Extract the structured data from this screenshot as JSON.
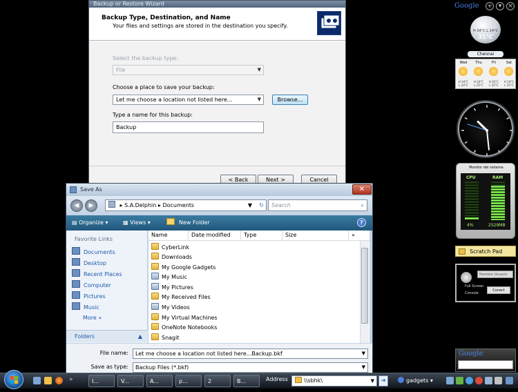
{
  "wizard": {
    "window_title": "Backup or Restore Wizard",
    "heading": "Backup Type, Destination, and Name",
    "subheading": "Your files and settings are stored in the destination you specify.",
    "backup_type_label": "Select the backup type:",
    "backup_type_value": "File",
    "place_label": "Choose a place to save your backup:",
    "place_value": "Let me choose a location not listed here...",
    "browse_label": "Browse...",
    "name_label": "Type a name for this backup:",
    "name_value": "Backup",
    "back_label": "< Back",
    "next_label": "Next >",
    "cancel_label": "Cancel"
  },
  "save_dialog": {
    "title": "Save As",
    "breadcrumb": [
      "S.A.Delphin",
      "Documents"
    ],
    "search_placeholder": "Search",
    "toolbar": {
      "organize": "Organize",
      "views": "Views",
      "new_folder": "New Folder"
    },
    "favorite_links_label": "Favorite Links",
    "favorites": [
      "Documents",
      "Desktop",
      "Recent Places",
      "Computer",
      "Pictures",
      "Music"
    ],
    "more_label": "More",
    "folders_label": "Folders",
    "columns": [
      "Name",
      "Date modified",
      "Type",
      "Size"
    ],
    "files": [
      "CyberLink",
      "Downloads",
      "My Google Gadgets",
      "My Music",
      "My Pictures",
      "My Received Files",
      "My Videos",
      "My Virtual Machines",
      "OneNote Notebooks",
      "Snagit"
    ],
    "file_name_label": "File name:",
    "file_name_value": "Let me choose a location not listed here...Backup.bkf",
    "save_type_label": "Save as type:",
    "save_type_value": "Backup Files (*.bkf)"
  },
  "sidebar": {
    "google_label": "Google",
    "weather": {
      "temp": "31°C",
      "hi_lo": "H 34°C L 24°C",
      "city": "Chennai",
      "days": [
        {
          "day": "Wed",
          "hi": "H 34°C",
          "lo": "L 24°C"
        },
        {
          "day": "Thu",
          "hi": "H 34°C",
          "lo": "L 25°C"
        },
        {
          "day": "Fri",
          "hi": "H 35°C",
          "lo": "L 25°C"
        },
        {
          "day": "Sat",
          "hi": "H 34°C",
          "lo": "L 25°C"
        }
      ]
    },
    "clock": {
      "hours": 10,
      "minutes": 29,
      "seconds": 48
    },
    "monitor": {
      "title": "Monitor del sistema",
      "cpu_label": "CPU",
      "ram_label": "RAM",
      "cpu_value": "4%",
      "ram_value": "2529MB",
      "cpu_pct": 4,
      "ram_pct": 90
    },
    "scratch_pad_label": "Scratch Pad",
    "console": {
      "user_placeholder": "Nombre Usuario",
      "fullscreen_label": "Full Screen",
      "console_label": "Console",
      "connect_label": "Conect"
    }
  },
  "taskbar": {
    "buttons": [
      "I...",
      "V...",
      "A...",
      "p...",
      "2",
      "B..."
    ],
    "address_label": "Address",
    "address_value": "\\\\sbhk\\",
    "gadgets_label": "gadgets"
  }
}
